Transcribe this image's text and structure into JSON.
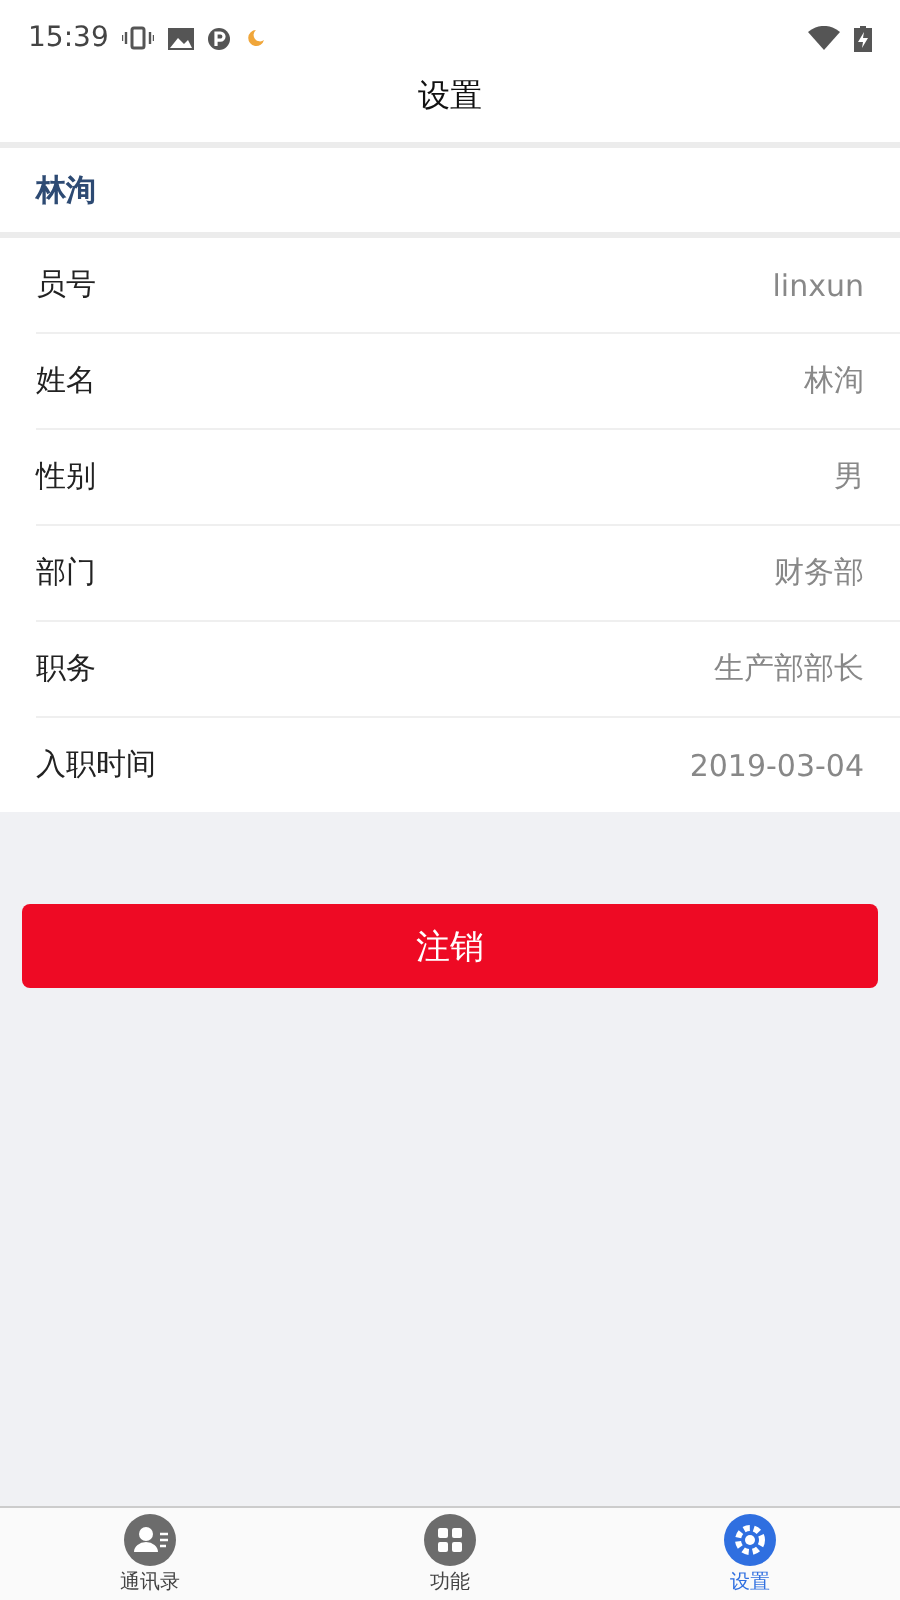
{
  "status_bar": {
    "time": "15:39"
  },
  "title": "设置",
  "section": "林洵",
  "fields": [
    {
      "label": "员号",
      "value": "linxun"
    },
    {
      "label": "姓名",
      "value": "林洵"
    },
    {
      "label": "性别",
      "value": "男"
    },
    {
      "label": "部门",
      "value": "财务部"
    },
    {
      "label": "职务",
      "value": "生产部部长"
    },
    {
      "label": "入职时间",
      "value": "2019-03-04"
    }
  ],
  "logout_button": "注销",
  "tabs": [
    {
      "label": "通讯录",
      "kind": "contacts",
      "selected": false
    },
    {
      "label": "功能",
      "kind": "grid",
      "selected": false
    },
    {
      "label": "设置",
      "kind": "settings",
      "selected": true
    }
  ]
}
